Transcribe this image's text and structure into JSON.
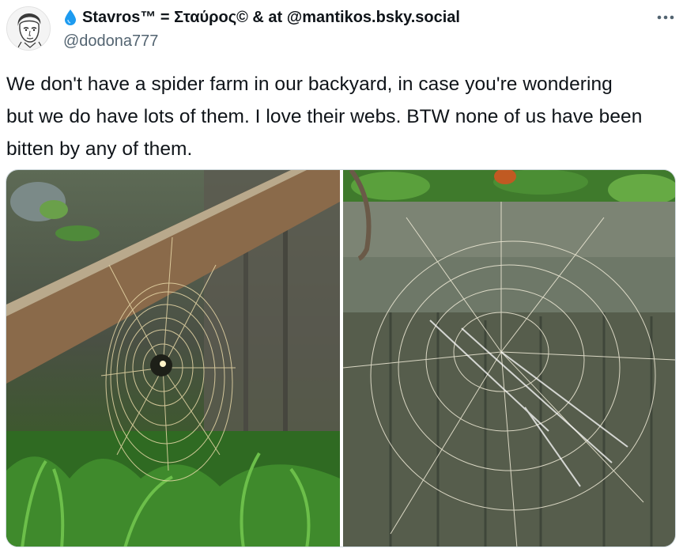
{
  "author": {
    "display_name": "Stavros™ = Σταύρος© & at @mantikos.bsky.social",
    "handle": "@dodona777",
    "avatar_icon": "sketch-portrait-avatar",
    "name_prefix_icon": "water-drop-icon"
  },
  "tweet": {
    "text_line_1": "We don't have a spider farm in our backyard, in case you're wondering",
    "text_line_2": "but we do have lots of them. I love their webs. BTW none of us have been",
    "text_line_3": "bitten by any of them."
  },
  "actions": {
    "more_icon": "more-horizontal-icon"
  },
  "media": {
    "photos": [
      {
        "subject": "orb-spider-web-wooden-rail"
      },
      {
        "subject": "spider-web-on-wooden-fence"
      }
    ]
  },
  "colors": {
    "text": "#0f1419",
    "secondary_text": "#536471",
    "border": "#cfd9de",
    "drop_blue": "#1d9bf0"
  }
}
